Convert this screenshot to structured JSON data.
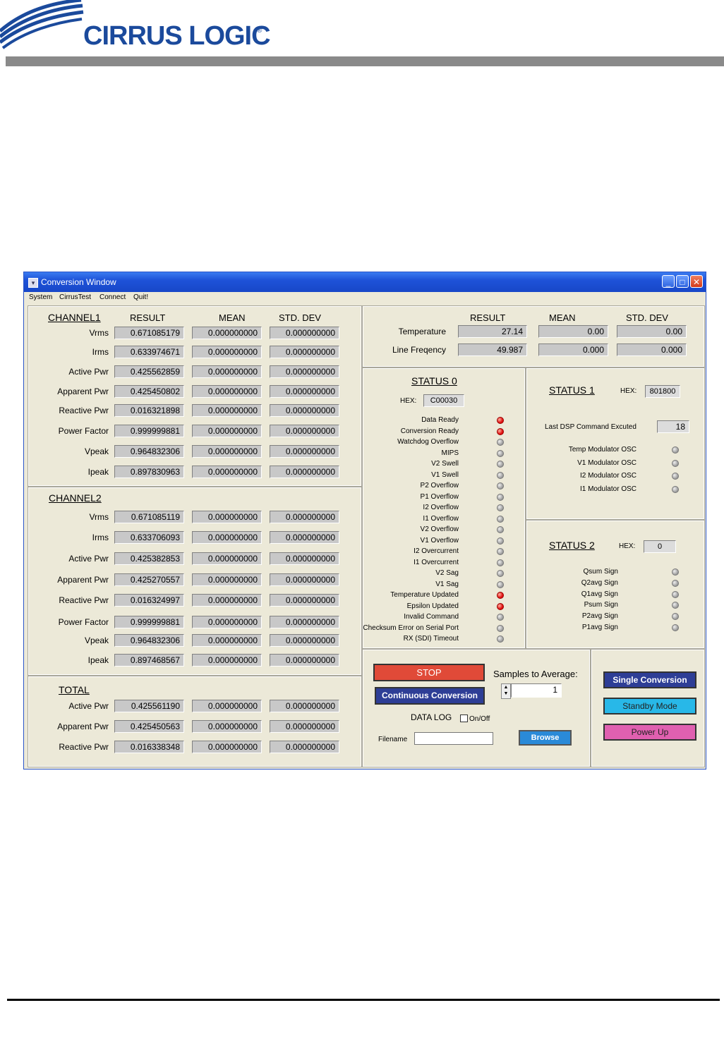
{
  "brand": {
    "logo_text": "CIRRUS LOGIC",
    "reg": "®",
    "color": "#1b4a9c"
  },
  "window": {
    "title": "Conversion Window",
    "title_icon": "window-menu-icon",
    "min": "_",
    "max": "□",
    "close": "✕"
  },
  "menu": [
    "System",
    "CirrusTest",
    "Connect",
    "Quit!"
  ],
  "columns": {
    "result": "RESULT",
    "mean": "MEAN",
    "std": "STD. DEV"
  },
  "channel1": {
    "title": "CHANNEL1",
    "rows": [
      {
        "label": "Vrms",
        "result": "0.671085179",
        "mean": "0.000000000",
        "std": "0.000000000"
      },
      {
        "label": "Irms",
        "result": "0.633974671",
        "mean": "0.000000000",
        "std": "0.000000000"
      },
      {
        "label": "Active Pwr",
        "result": "0.425562859",
        "mean": "0.000000000",
        "std": "0.000000000"
      },
      {
        "label": "Apparent Pwr",
        "result": "0.425450802",
        "mean": "0.000000000",
        "std": "0.000000000"
      },
      {
        "label": "Reactive Pwr",
        "result": "0.016321898",
        "mean": "0.000000000",
        "std": "0.000000000"
      },
      {
        "label": "Power Factor",
        "result": "0.999999881",
        "mean": "0.000000000",
        "std": "0.000000000"
      },
      {
        "label": "Vpeak",
        "result": "0.964832306",
        "mean": "0.000000000",
        "std": "0.000000000"
      },
      {
        "label": "Ipeak",
        "result": "0.897830963",
        "mean": "0.000000000",
        "std": "0.000000000"
      }
    ]
  },
  "channel2": {
    "title": "CHANNEL2",
    "rows": [
      {
        "label": "Vrms",
        "result": "0.671085119",
        "mean": "0.000000000",
        "std": "0.000000000"
      },
      {
        "label": "Irms",
        "result": "0.633706093",
        "mean": "0.000000000",
        "std": "0.000000000"
      },
      {
        "label": "Active Pwr",
        "result": "0.425382853",
        "mean": "0.000000000",
        "std": "0.000000000"
      },
      {
        "label": "Apparent Pwr",
        "result": "0.425270557",
        "mean": "0.000000000",
        "std": "0.000000000"
      },
      {
        "label": "Reactive Pwr",
        "result": "0.016324997",
        "mean": "0.000000000",
        "std": "0.000000000"
      },
      {
        "label": "Power Factor",
        "result": "0.999999881",
        "mean": "0.000000000",
        "std": "0.000000000"
      },
      {
        "label": "Vpeak",
        "result": "0.964832306",
        "mean": "0.000000000",
        "std": "0.000000000"
      },
      {
        "label": "Ipeak",
        "result": "0.897468567",
        "mean": "0.000000000",
        "std": "0.000000000"
      }
    ]
  },
  "total": {
    "title": "TOTAL",
    "rows": [
      {
        "label": "Active Pwr",
        "result": "0.425561190",
        "mean": "0.000000000",
        "std": "0.000000000"
      },
      {
        "label": "Apparent Pwr",
        "result": "0.425450563",
        "mean": "0.000000000",
        "std": "0.000000000"
      },
      {
        "label": "Reactive Pwr",
        "result": "0.016338348",
        "mean": "0.000000000",
        "std": "0.000000000"
      }
    ]
  },
  "misc": {
    "rows": [
      {
        "label": "Temperature",
        "result": "27.14",
        "mean": "0.00",
        "std": "0.00"
      },
      {
        "label": "Line Freqency",
        "result": "49.987",
        "mean": "0.000",
        "std": "0.000"
      }
    ]
  },
  "status0": {
    "title": "STATUS 0",
    "hex_label": "HEX:",
    "hex": "C00030",
    "items": [
      {
        "label": "Data Ready",
        "on": true
      },
      {
        "label": "Conversion Ready",
        "on": true
      },
      {
        "label": "Watchdog Overflow",
        "on": false
      },
      {
        "label": "MIPS",
        "on": false
      },
      {
        "label": "V2 Swell",
        "on": false
      },
      {
        "label": "V1 Swell",
        "on": false
      },
      {
        "label": "P2 Overflow",
        "on": false
      },
      {
        "label": "P1 Overflow",
        "on": false
      },
      {
        "label": "I2 Overflow",
        "on": false
      },
      {
        "label": "I1 Overflow",
        "on": false
      },
      {
        "label": "V2 Overflow",
        "on": false
      },
      {
        "label": "V1 Overflow",
        "on": false
      },
      {
        "label": "I2 Overcurrent",
        "on": false
      },
      {
        "label": "I1 Overcurrent",
        "on": false
      },
      {
        "label": "V2 Sag",
        "on": false
      },
      {
        "label": "V1 Sag",
        "on": false
      },
      {
        "label": "Temperature Updated",
        "on": true
      },
      {
        "label": "Epsilon Updated",
        "on": true
      },
      {
        "label": "Invalid Command",
        "on": false
      },
      {
        "label": "Checksum Error on Serial Port",
        "on": false
      },
      {
        "label": "RX (SDI) Timeout",
        "on": false
      }
    ]
  },
  "status1": {
    "title": "STATUS 1",
    "hex_label": "HEX:",
    "hex": "801800",
    "last_cmd_label": "Last DSP Command Excuted",
    "last_cmd": "18",
    "items": [
      {
        "label": "Temp Modulator OSC",
        "on": false
      },
      {
        "label": "V1 Modulator OSC",
        "on": false
      },
      {
        "label": "I2 Modulator OSC",
        "on": false
      },
      {
        "label": "I1 Modulator OSC",
        "on": false
      }
    ]
  },
  "status2": {
    "title": "STATUS 2",
    "hex_label": "HEX:",
    "hex": "0",
    "items": [
      {
        "label": "Qsum Sign",
        "on": false
      },
      {
        "label": "Q2avg Sign",
        "on": false
      },
      {
        "label": "Q1avg Sign",
        "on": false
      },
      {
        "label": "Psum Sign",
        "on": false
      },
      {
        "label": "P2avg Sign",
        "on": false
      },
      {
        "label": "P1avg Sign",
        "on": false
      }
    ]
  },
  "controls": {
    "stop": "STOP",
    "continuous": "Continuous Conversion",
    "samples_label": "Samples to Average:",
    "samples_value": "1",
    "datalog_label": "DATA LOG",
    "onoff_label": "On/Off",
    "filename_label": "Filename",
    "filename_value": "",
    "browse": "Browse",
    "single": "Single Conversion",
    "standby": "Standby Mode",
    "powerup": "Power Up"
  },
  "colors": {
    "stop": "#e04a38",
    "navy": "#2e3e96",
    "cyan": "#28b8e8",
    "pink": "#e060b0",
    "browse": "#2a8ad8"
  }
}
